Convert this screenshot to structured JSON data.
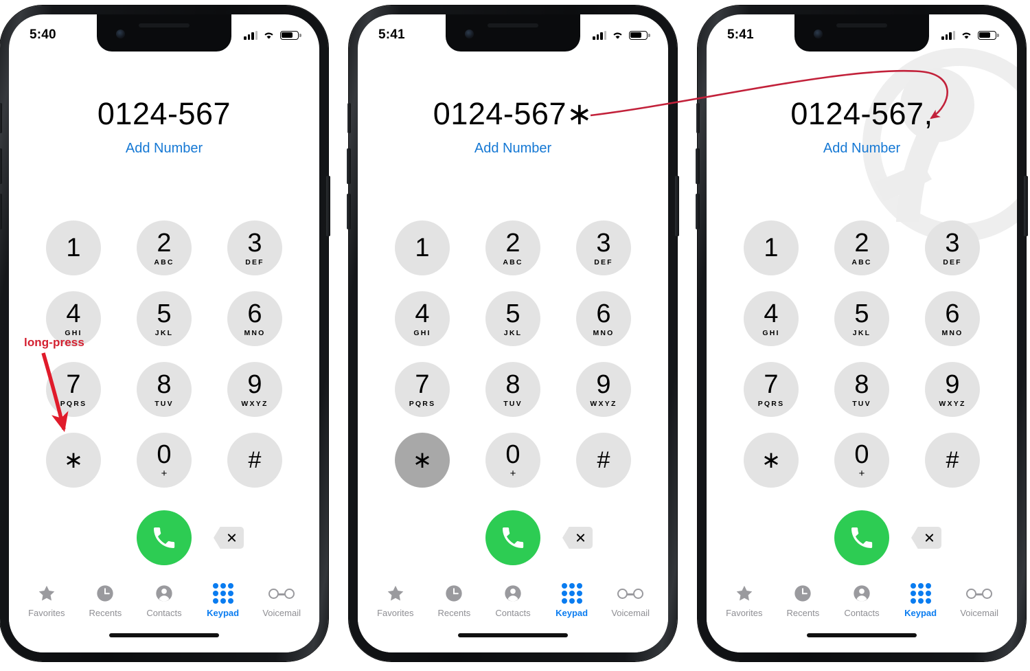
{
  "meta": {
    "app": "Phone",
    "screen": "Keypad",
    "panel_count": 3
  },
  "colors": {
    "accent_blue": "#0a7cf0",
    "link_blue": "#1578d4",
    "call_green": "#2dcc53",
    "key_gray": "#e3e3e3",
    "key_pressed_gray": "#a8a8a8",
    "tab_inactive_gray": "#8e8e93",
    "annotation_red": "#d42030"
  },
  "keypad": {
    "keys": [
      {
        "digit": "1",
        "letters": ""
      },
      {
        "digit": "2",
        "letters": "ABC"
      },
      {
        "digit": "3",
        "letters": "DEF"
      },
      {
        "digit": "4",
        "letters": "GHI"
      },
      {
        "digit": "5",
        "letters": "JKL"
      },
      {
        "digit": "6",
        "letters": "MNO"
      },
      {
        "digit": "7",
        "letters": "PQRS"
      },
      {
        "digit": "8",
        "letters": "TUV"
      },
      {
        "digit": "9",
        "letters": "WXYZ"
      },
      {
        "digit": "∗",
        "letters": ""
      },
      {
        "digit": "0",
        "letters": "+"
      },
      {
        "digit": "#",
        "letters": ""
      }
    ],
    "call_button_label": "call-button",
    "delete_button_label": "delete-button"
  },
  "tabbar": {
    "items": [
      {
        "label": "Favorites",
        "icon": "star-icon",
        "active": false
      },
      {
        "label": "Recents",
        "icon": "clock-icon",
        "active": false
      },
      {
        "label": "Contacts",
        "icon": "person-icon",
        "active": false
      },
      {
        "label": "Keypad",
        "icon": "keypad-dots-icon",
        "active": true
      },
      {
        "label": "Voicemail",
        "icon": "voicemail-icon",
        "active": false
      }
    ]
  },
  "panels": [
    {
      "id": "panel-1",
      "status": {
        "time": "5:40",
        "signal": "signal-icon",
        "wifi": "wifi-icon",
        "battery": "battery-icon"
      },
      "dialed_number": "0124-567",
      "add_number_label": "Add Number",
      "pressed_key": null,
      "watermark": false
    },
    {
      "id": "panel-2",
      "status": {
        "time": "5:41",
        "signal": "signal-icon",
        "wifi": "wifi-icon",
        "battery": "battery-icon"
      },
      "dialed_number": "0124-567∗",
      "add_number_label": "Add Number",
      "pressed_key": "∗",
      "watermark": false
    },
    {
      "id": "panel-3",
      "status": {
        "time": "5:41",
        "signal": "signal-icon",
        "wifi": "wifi-icon",
        "battery": "battery-icon"
      },
      "dialed_number": "0124-567,",
      "add_number_label": "Add Number",
      "pressed_key": null,
      "watermark": true
    }
  ],
  "annotations": {
    "long_press_label": "long-press",
    "arrow_long_press": "red-arrow-to-star-key",
    "arrow_star_to_comma": "red-curved-arrow-star-becomes-comma"
  }
}
